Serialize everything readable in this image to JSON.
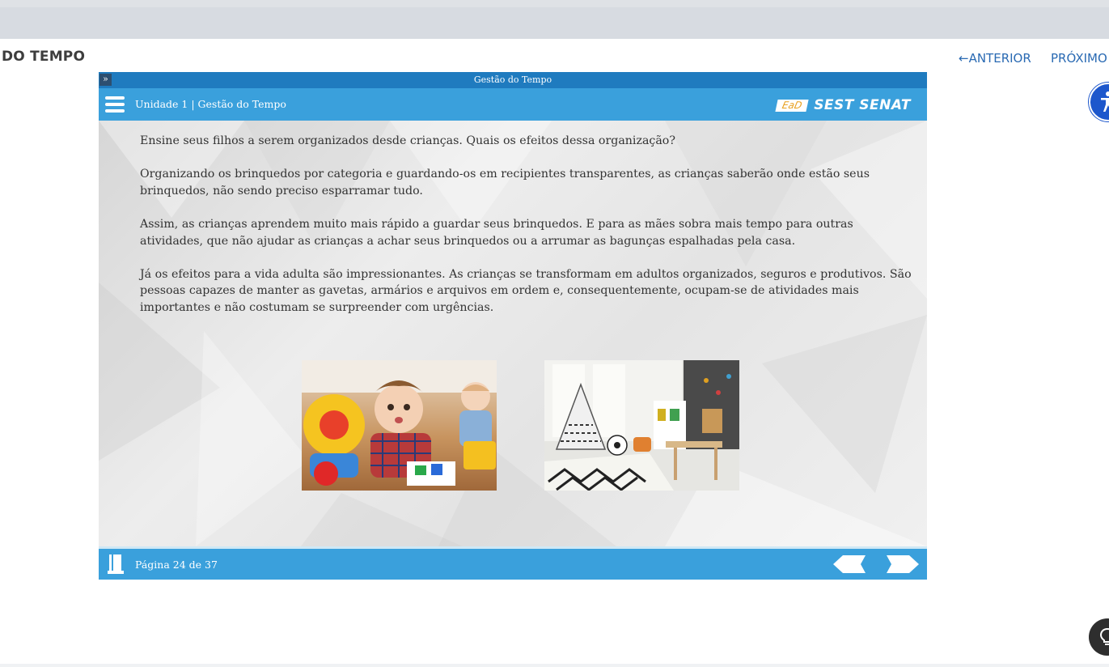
{
  "page": {
    "course_title": "DO TEMPO",
    "nav_prev_label": "ANTERIOR",
    "nav_next_label": "PRÓXIMO"
  },
  "player": {
    "strip_title": "Gestão do Tempo",
    "unit_title": "Unidade 1 | Gestão do Tempo",
    "logo": {
      "ead": "EaD",
      "brand": "SEST SENAT"
    },
    "paragraphs": [
      "Ensine seus filhos a serem organizados desde crianças. Quais os efeitos dessa organização?",
      "Organizando os brinquedos por categoria e guardando-os em recipientes transparentes, as crianças saberão onde estão seus brinquedos, não sendo preciso esparramar tudo.",
      "Assim, as crianças aprendem muito mais rápido a guardar seus brinquedos. E para as mães sobra mais tempo para outras atividades, que não ajudar as crianças a achar seus brinquedos ou a arrumar as bagunças espalhadas pela casa.",
      "Já os efeitos para a vida adulta são impressionantes. As crianças se transformam em adultos organizados, seguros e produtivos. São pessoas capazes de manter as gavetas, armários e arquivos em ordem e, consequentemente, ocupam-se de atividades mais importantes e não costumam se surpreender com urgências."
    ],
    "page_indicator": "Página 24 de 37"
  },
  "colors": {
    "header_blue": "#3aa0dc",
    "strip_blue": "#1f7bbf",
    "link_blue": "#2a6ab3",
    "accessibility_blue": "#1d57cc"
  },
  "icons": [
    "arrow-left-icon",
    "accessibility-icon",
    "lightbulb-icon",
    "menu-icon",
    "double-chevron-icon",
    "book-icon",
    "prev-arrow-icon",
    "next-arrow-icon"
  ]
}
